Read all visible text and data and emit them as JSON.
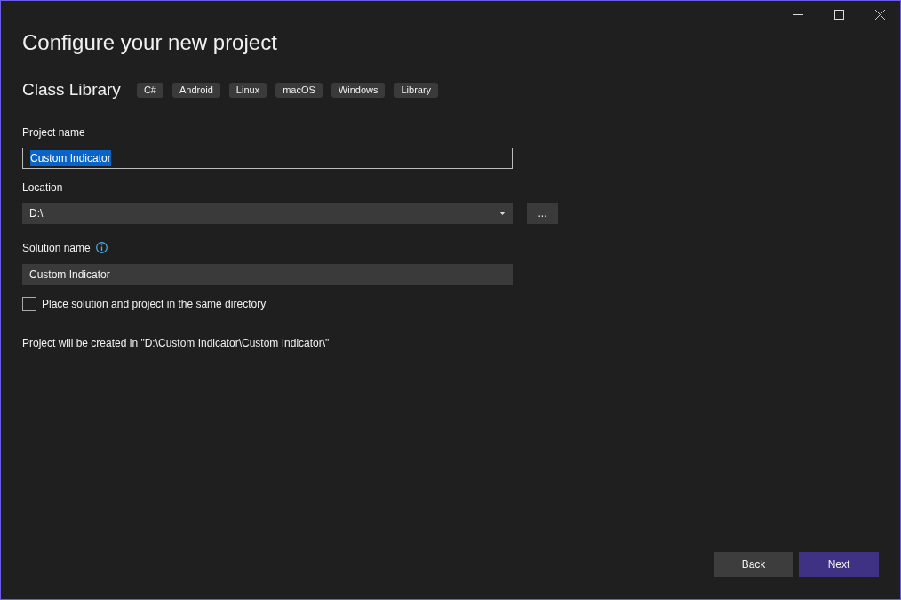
{
  "title": "Configure your new project",
  "template": {
    "name": "Class Library",
    "tags": [
      "C#",
      "Android",
      "Linux",
      "macOS",
      "Windows",
      "Library"
    ]
  },
  "project_name": {
    "label": "Project name",
    "value": "Custom Indicator",
    "text_selected": true
  },
  "location": {
    "label": "Location",
    "value": "D:\\",
    "browse": "..."
  },
  "solution_name": {
    "label": "Solution name",
    "value": "Custom Indicator"
  },
  "same_directory": {
    "label": "Place solution and project in the same directory",
    "checked": false
  },
  "path_note": "Project will be created in \"D:\\Custom Indicator\\Custom Indicator\\\"",
  "buttons": [
    {
      "label": "Back",
      "primary": false
    },
    {
      "label": "Next",
      "primary": true
    }
  ]
}
